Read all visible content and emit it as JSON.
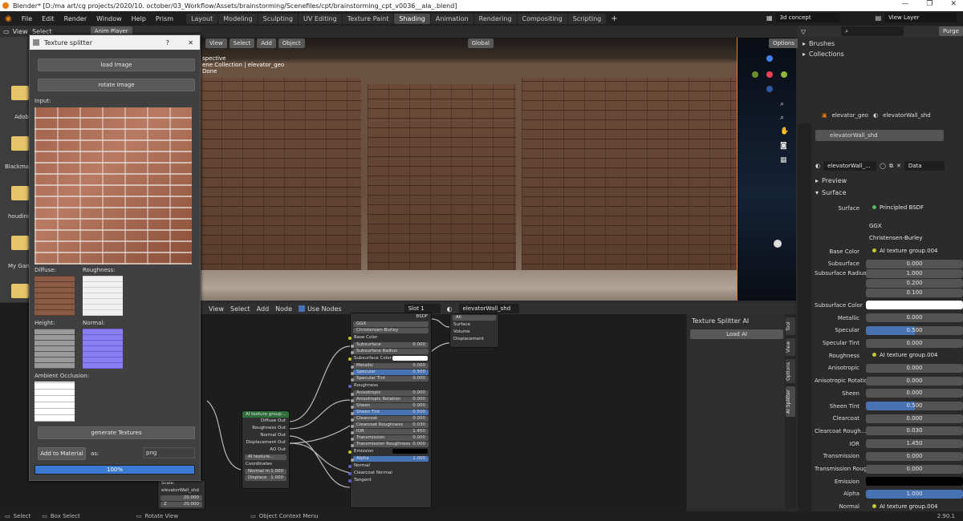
{
  "titlebar": {
    "text": "Blender* [D:/ma art/cg projects/2020/10. october/03_Workflow/Assets/brainstorming/Scenefiles/cpt/brainstorming_cpt_v0036__ala_.blend]"
  },
  "menu": [
    "File",
    "Edit",
    "Render",
    "Window",
    "Help",
    "Prism"
  ],
  "workspaces": [
    "Layout",
    "Modeling",
    "Sculpting",
    "UV Editing",
    "Texture Paint",
    "Shading",
    "Animation",
    "Rendering",
    "Compositing",
    "Scripting"
  ],
  "active_workspace": "Shading",
  "scene_name": "3d concept",
  "view_layer": "View Layer",
  "left_editor": {
    "view": "View",
    "select": "Select",
    "anim_player": "Anim Player"
  },
  "folders": [
    "Adob",
    "Blackma",
    "houdini1",
    "My Gan",
    ""
  ],
  "viewport": {
    "header": [
      "View",
      "Select",
      "Add",
      "Object"
    ],
    "overlay_lines": [
      "spective",
      "ene Collection | elevator_geo",
      "Done"
    ],
    "transform": "Global",
    "options": "Options"
  },
  "texture_splitter": {
    "title": "Texture splitter",
    "help": "?",
    "close": "✕",
    "load_image": "load Image",
    "rotate_image": "rotate Image",
    "input_label": "Input:",
    "diffuse_label": "Diffuse:",
    "roughness_label": "Roughness:",
    "height_label": "Height:",
    "normal_label": "Normal:",
    "ao_label": "Ambient Occlusion:",
    "generate": "generate Textures",
    "add_to_material": "Add to Material",
    "as_label": "as:",
    "format": "png",
    "progress_text": "100%",
    "progress": 1.0
  },
  "node_editor": {
    "header": [
      "View",
      "Select",
      "Add",
      "Node"
    ],
    "use_nodes": "Use Nodes",
    "slot": "Slot 1",
    "material": "elevatorWall_shd",
    "scale_label": "Scale:",
    "mat_label": "elevatorWall_shd",
    "y_val": "20.000",
    "z_label": "Z",
    "z_val": "20.000",
    "ai_node": {
      "title": "AI texture group...",
      "outputs": [
        "Diffuse Out",
        "Roughness Out",
        "Normal Out",
        "Displacement Out",
        "AO Out"
      ],
      "sub": "AI texture...",
      "inputs": [
        "Coordinates"
      ],
      "normal_label": "Normal m",
      "normal_val": "1.000",
      "displace_label": "Displace",
      "displace_val": "1.000"
    },
    "bsdf_node": {
      "out": "BSDF",
      "dist": "GGX",
      "sss": "Christensen-Burley",
      "fields": [
        {
          "l": "Base Color",
          "v": "",
          "t": "label"
        },
        {
          "l": "Subsurface",
          "v": "0.000",
          "t": "f"
        },
        {
          "l": "Subsurface Radius",
          "v": "",
          "t": "f"
        },
        {
          "l": "Subsurface Color",
          "v": "",
          "t": "color"
        },
        {
          "l": "Metallic",
          "v": "0.000",
          "t": "f"
        },
        {
          "l": "Specular",
          "v": "0.500",
          "t": "blue"
        },
        {
          "l": "Specular Tint",
          "v": "0.000",
          "t": "f"
        },
        {
          "l": "Roughness",
          "v": "",
          "t": "label"
        },
        {
          "l": "Anisotropic",
          "v": "0.000",
          "t": "f"
        },
        {
          "l": "Anisotropic Rotation",
          "v": "0.000",
          "t": "f"
        },
        {
          "l": "Sheen",
          "v": "0.000",
          "t": "f"
        },
        {
          "l": "Sheen Tint",
          "v": "0.500",
          "t": "blue"
        },
        {
          "l": "Clearcoat",
          "v": "0.000",
          "t": "f"
        },
        {
          "l": "Clearcoat Roughness",
          "v": "0.030",
          "t": "f"
        },
        {
          "l": "IOR",
          "v": "1.450",
          "t": "f"
        },
        {
          "l": "Transmission",
          "v": "0.000",
          "t": "f"
        },
        {
          "l": "Transmission Roughness",
          "v": "0.000",
          "t": "f"
        },
        {
          "l": "Emission",
          "v": "",
          "t": "black"
        },
        {
          "l": "Alpha",
          "v": "1.000",
          "t": "blue"
        },
        {
          "l": "Normal",
          "v": "",
          "t": "label"
        },
        {
          "l": "Clearcoat Normal",
          "v": "",
          "t": "label"
        },
        {
          "l": "Tangent",
          "v": "",
          "t": "label"
        }
      ]
    },
    "output_node": {
      "target": "All",
      "inputs": [
        "Surface",
        "Volume",
        "Displacement"
      ]
    }
  },
  "ai_panel": {
    "title": "Texture Splitter AI",
    "load": "Load AI",
    "tabs": [
      "Tool",
      "View",
      "Options",
      "AI Splitter"
    ]
  },
  "outliner": {
    "items": [
      "Brushes",
      "Collections"
    ]
  },
  "properties": {
    "object": "elevator_geo",
    "material": "elevatorWall_shd",
    "slot_item": "elevatorWall_shd",
    "mat_field": "elevatorWall_...",
    "data": "Data",
    "preview": "Preview",
    "surface_section": "Surface",
    "surface_label": "Surface",
    "surface_val": "Principled BSDF",
    "dist": "GGX",
    "sss": "Christensen-Burley",
    "rows": [
      {
        "l": "Base Color",
        "v": "AI texture group.004",
        "t": "link"
      },
      {
        "l": "Subsurface",
        "v": "0.000",
        "t": "num"
      },
      {
        "l": "Subsurface Radius",
        "v": "1.000",
        "t": "num"
      },
      {
        "l": "",
        "v": "0.200",
        "t": "num"
      },
      {
        "l": "",
        "v": "0.100",
        "t": "num"
      },
      {
        "l": "Subsurface Color",
        "v": "",
        "t": "white"
      },
      {
        "l": "Metallic",
        "v": "0.000",
        "t": "num"
      },
      {
        "l": "Specular",
        "v": "0.500",
        "t": "blue"
      },
      {
        "l": "Specular Tint",
        "v": "0.000",
        "t": "num"
      },
      {
        "l": "Roughness",
        "v": "AI texture group.004",
        "t": "link"
      },
      {
        "l": "Anisotropic",
        "v": "0.000",
        "t": "num"
      },
      {
        "l": "Anisotropic Rotatio",
        "v": "0.000",
        "t": "num"
      },
      {
        "l": "Sheen",
        "v": "0.000",
        "t": "num"
      },
      {
        "l": "Sheen Tint",
        "v": "0.500",
        "t": "blue"
      },
      {
        "l": "Clearcoat",
        "v": "0.000",
        "t": "num"
      },
      {
        "l": "Clearcoat Rough...",
        "v": "0.030",
        "t": "num"
      },
      {
        "l": "IOR",
        "v": "1.450",
        "t": "num"
      },
      {
        "l": "Transmission",
        "v": "0.000",
        "t": "num"
      },
      {
        "l": "Transmission Roug...",
        "v": "0.000",
        "t": "num"
      },
      {
        "l": "Emission",
        "v": "",
        "t": "black"
      },
      {
        "l": "Alpha",
        "v": "1.000",
        "t": "fullblue"
      },
      {
        "l": "Normal",
        "v": "AI texture group.004",
        "t": "link"
      }
    ]
  },
  "status": {
    "select": "Select",
    "box": "Box Select",
    "rotate": "Rotate View",
    "ctx": "Object Context Menu",
    "version": "2.90.1"
  }
}
